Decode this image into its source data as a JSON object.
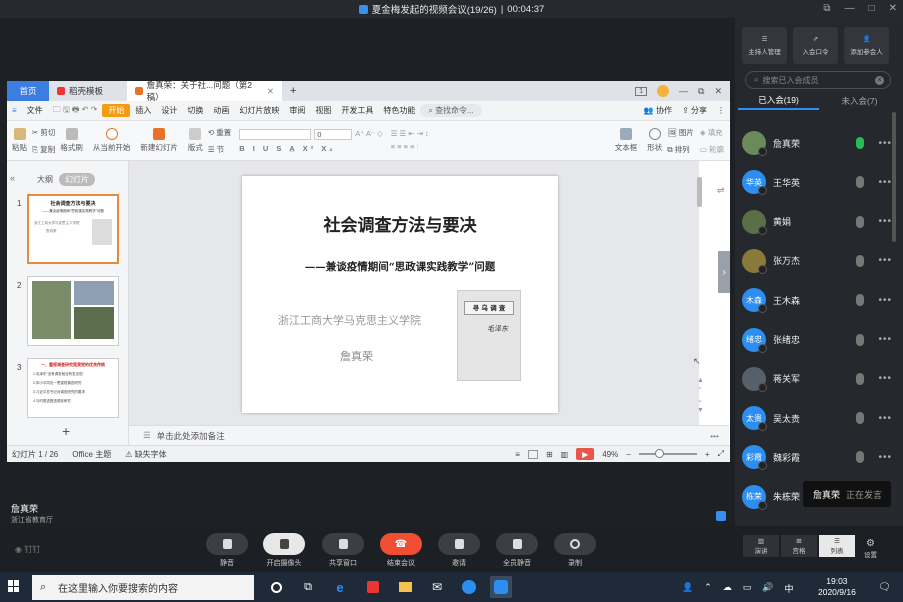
{
  "window": {
    "title": "夏金梅发起的视频会议(19/26)",
    "separator": "|",
    "timer": "00:04:37"
  },
  "wps": {
    "tabs": [
      "首页",
      "稻壳模板",
      "詹真荣：关于社...问题（第2稿）"
    ],
    "page_indicator": "1",
    "menu": [
      "文件",
      "开始",
      "插入",
      "设计",
      "切换",
      "动画",
      "幻灯片放映",
      "审阅",
      "视图",
      "开发工具",
      "特色功能"
    ],
    "search": "查找命令...",
    "collab": "协作",
    "share": "分享",
    "ribbon": {
      "cut": "剪切",
      "paste": "粘贴",
      "copy": "复制",
      "format_painter": "格式刷",
      "from_current": "从当前开始",
      "new_slide": "新建幻灯片",
      "layout": "版式",
      "section": "节",
      "reset": "重置",
      "font_size": "0",
      "textbox": "文本框",
      "shape": "形状",
      "picture": "图片",
      "fill": "填充",
      "arrange": "排列",
      "outline": "轮廓"
    },
    "left_tabs": [
      "大纲",
      "幻灯片"
    ],
    "thumbs": [
      {
        "num": "1",
        "title": "社会调查方法与要决",
        "subtitle": "——兼谈疫情期间“思政课实践教学”问题",
        "lines": [
          "浙江工商大学马克思主义学院",
          "詹真荣"
        ]
      },
      {
        "num": "2"
      },
      {
        "num": "3",
        "title": "一、重视调查研究是我党的优良传统",
        "lines": [
          "1.毛泽东“没有调查就没有发言权”",
          "2.邓小平同志一贯重视调查研究",
          "3.习近平总书记对调查研究的要求",
          "4.与时俱进推进调查研究"
        ]
      }
    ],
    "add_slide": "+",
    "slide": {
      "title": "社会调查方法与要决",
      "subtitle": "——兼谈疫情期间“思政课实践教学”问题",
      "institution": "浙江工商大学马克思主义学院",
      "author": "詹真荣",
      "book_title": "寻 乌 调 查",
      "book_author": "毛泽东"
    },
    "notes_placeholder": "单击此处添加备注",
    "status": {
      "slide": "幻灯片 1 / 26",
      "theme": "Office 主题",
      "missing_font": "缺失字体",
      "zoom": "49%"
    }
  },
  "speaker": {
    "name": "詹真荣",
    "org": "浙江省教育厅"
  },
  "brand": "钉钉",
  "right_panel": {
    "tools": [
      "主持人管理",
      "入会口令",
      "添加参会人"
    ],
    "search_placeholder": "搜索已入会成员",
    "tab_joined": "已入会(19)",
    "tab_not_joined": "未入会(7)",
    "members": [
      {
        "name": "詹真荣",
        "avatar": "",
        "mic_on": true
      },
      {
        "name": "王华英",
        "avatar": "华英",
        "mic_on": false
      },
      {
        "name": "黄娟",
        "avatar": "",
        "mic_on": false
      },
      {
        "name": "张万杰",
        "avatar": "",
        "mic_on": false
      },
      {
        "name": "王木森",
        "avatar": "木森",
        "mic_on": false
      },
      {
        "name": "张绪忠",
        "avatar": "绪忠",
        "mic_on": false
      },
      {
        "name": "蒋关军",
        "avatar": "",
        "mic_on": false
      },
      {
        "name": "吴太贵",
        "avatar": "太贵",
        "mic_on": false
      },
      {
        "name": "魏彩霞",
        "avatar": "彩霞",
        "mic_on": false
      },
      {
        "name": "朱栋荣",
        "avatar": "栋荣",
        "mic_on": false
      }
    ],
    "tooltip_name": "詹真荣",
    "tooltip_status": "正在发言"
  },
  "toolbar": {
    "buttons": [
      "静音",
      "开启摄像头",
      "共享窗口",
      "结束会议",
      "邀请",
      "全员静音",
      "录制"
    ],
    "views": [
      "演讲",
      "宫格",
      "列表"
    ],
    "settings": "设置"
  },
  "taskbar": {
    "search_placeholder": "在这里输入你要搜索的内容",
    "ime": "中",
    "time": "19:03",
    "date": "2020/9/16"
  }
}
